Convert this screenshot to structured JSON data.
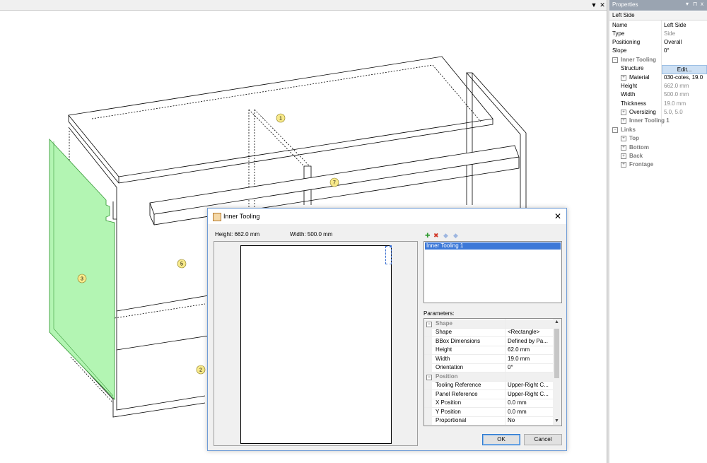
{
  "viewport": {
    "pin_glyph": "▼",
    "close_glyph": "✕",
    "part_labels": [
      "1",
      "7",
      "5",
      "3",
      "2"
    ]
  },
  "properties": {
    "title": "Properties",
    "pin_glyph": "▾",
    "dock_glyph": "⊓",
    "close_glyph": "x",
    "selected_object": "Left Side",
    "rows": [
      {
        "key": "Name",
        "value": "Left Side"
      },
      {
        "key": "Type",
        "value": "Side"
      },
      {
        "key": "Positioning",
        "value": "Overall"
      },
      {
        "key": "Slope",
        "value": "0°"
      }
    ],
    "inner_tooling": {
      "label": "Inner Tooling",
      "structure_label": "Structure",
      "edit_label": "Edit...",
      "rows": [
        {
          "key": "Material",
          "value": "030-cotes, 19.0"
        },
        {
          "key": "Height",
          "value": "662.0 mm"
        },
        {
          "key": "Width",
          "value": "500.0 mm"
        },
        {
          "key": "Thickness",
          "value": "19.0 mm"
        },
        {
          "key": "Oversizing",
          "value": "5.0, 5.0"
        }
      ],
      "child": "Inner Tooling 1"
    },
    "links": {
      "label": "Links",
      "items": [
        "Top",
        "Bottom",
        "Back",
        "Frontage"
      ]
    }
  },
  "dialog": {
    "title": "Inner Tooling",
    "close_glyph": "✕",
    "height_label": "Height: 662.0 mm",
    "width_label": "Width: 500.0 mm",
    "toolbar": {
      "add": "✚",
      "delete": "✖",
      "down": "◆",
      "up": "◆"
    },
    "tooling_list": [
      "Inner Tooling 1"
    ],
    "parameters_label": "Parameters:",
    "params": [
      {
        "section": "Shape"
      },
      {
        "key": "Shape",
        "value": "<Rectangle>"
      },
      {
        "key": "BBox Dimensions",
        "value": "Defined by Pa..."
      },
      {
        "key": "Height",
        "value": "62.0 mm"
      },
      {
        "key": "Width",
        "value": "19.0 mm"
      },
      {
        "key": "Orientation",
        "value": "0°"
      },
      {
        "section": "Position"
      },
      {
        "key": "Tooling Reference",
        "value": "Upper-Right C..."
      },
      {
        "key": "Panel Reference",
        "value": "Upper-Right C..."
      },
      {
        "key": "X Position",
        "value": "0.0 mm"
      },
      {
        "key": "Y Position",
        "value": "0.0 mm"
      },
      {
        "key": "Proportional",
        "value": "No"
      }
    ],
    "ok_label": "OK",
    "cancel_label": "Cancel"
  },
  "colors": {
    "selection_green": "#b3f5b3",
    "list_selection": "#3c78d8",
    "props_header": "#9aa4b1"
  }
}
